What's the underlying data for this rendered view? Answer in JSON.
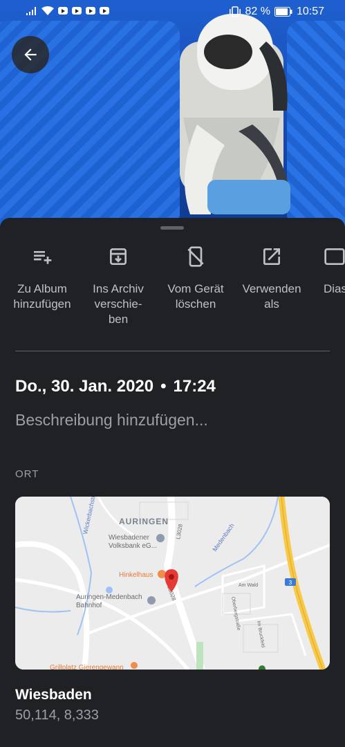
{
  "status_bar": {
    "battery_percent": "82 %",
    "time": "10:57"
  },
  "actions": [
    {
      "label": "Zu Album\nhinzufügen",
      "icon": "playlist-add-icon"
    },
    {
      "label": "Ins Archiv\nverschie-\nben",
      "icon": "archive-icon"
    },
    {
      "label": "Vom Gerät\nlöschen",
      "icon": "phone-delete-icon"
    },
    {
      "label": "Verwenden\nals",
      "icon": "open-in-new-icon"
    },
    {
      "label": "Dias",
      "icon": "slideshow-icon"
    }
  ],
  "details": {
    "date": "Do., 30. Jan. 2020",
    "separator": "•",
    "time": "17:24",
    "description_placeholder": "Beschreibung hinzufügen..."
  },
  "location": {
    "section_title": "ORT",
    "map_labels": {
      "town": "AURINGEN",
      "bank": "Wiesbadener\nVolksbank eG...",
      "restaurant": "Hinkelhaus",
      "station": "Auringen-Medenbach\nBahnhof",
      "grill": "Grillplatz Gierengewann",
      "street1": "Wickerbachstr.",
      "street2": "Medenbach",
      "road_l3028_a": "L3028",
      "road_l3028_b": "L3028",
      "street3": "Am Wald",
      "street4": "Oberbergstraße",
      "street5": "Im Bruckfeld",
      "highway": "3"
    },
    "place_name": "Wiesbaden",
    "coordinates": "50,114, 8,333"
  },
  "colors": {
    "background": "#202124",
    "text_primary": "#ffffff",
    "text_secondary": "#9aa0a6",
    "map_pin": "#e53935",
    "highway": "#f7c948"
  }
}
